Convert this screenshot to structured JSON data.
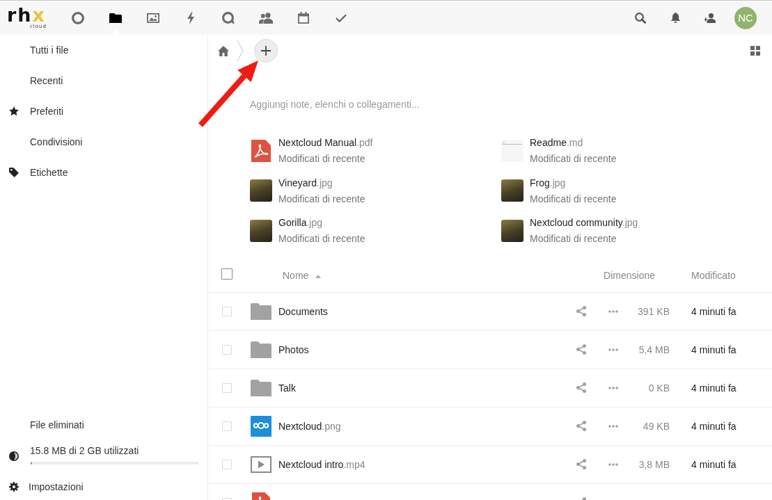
{
  "header": {
    "logo": {
      "parts": [
        {
          "text": "rh",
          "accent": false
        },
        {
          "text": "x",
          "accent": true
        }
      ],
      "subtitle": "cloud"
    },
    "apps": [
      {
        "kind": "ring",
        "selected": false
      },
      {
        "kind": "folder",
        "selected": true
      },
      {
        "kind": "image",
        "selected": false
      },
      {
        "kind": "bolt",
        "selected": false
      },
      {
        "kind": "chat",
        "selected": false
      },
      {
        "kind": "people",
        "selected": false
      },
      {
        "kind": "calendar",
        "selected": false
      },
      {
        "kind": "check",
        "selected": false
      }
    ],
    "tools": [
      {
        "kind": "search"
      },
      {
        "kind": "bell"
      },
      {
        "kind": "person"
      }
    ],
    "avatar": {
      "initials": "NC"
    }
  },
  "sidebar": {
    "items": [
      {
        "kind": "plain",
        "label": "Tutti i file"
      },
      {
        "kind": "plain",
        "label": "Recenti"
      },
      {
        "kind": "star",
        "label": "Preferiti"
      },
      {
        "kind": "plain",
        "label": "Condivisioni"
      },
      {
        "kind": "tag",
        "label": "Etichette"
      }
    ],
    "footer": [
      {
        "kind": "link",
        "label": "File eliminati"
      },
      {
        "kind": "quota",
        "label": "15.8 MB di 2 GB utilizzati",
        "level": 0.008
      },
      {
        "kind": "settings",
        "label": "Impostazioni"
      }
    ]
  },
  "controls": {
    "breadcrumbs": [
      {
        "kind": "home"
      }
    ],
    "new_button": {
      "kind": "plus"
    },
    "view_switch": {
      "kind": "grid"
    }
  },
  "workspace": {
    "placeholder": "Aggiungi note, elenchi o collegamenti..."
  },
  "recent": [
    {
      "kind": "pdf",
      "name": "Nextcloud Manual",
      "ext": ".pdf",
      "subtitle": "Modificati di recente"
    },
    {
      "kind": "text",
      "name": "Readme",
      "ext": ".md",
      "subtitle": "Modificati di recente"
    },
    {
      "kind": "photo",
      "name": "Vineyard",
      "ext": ".jpg",
      "subtitle": "Modificati di recente"
    },
    {
      "kind": "photo",
      "name": "Frog",
      "ext": ".jpg",
      "subtitle": "Modificati di recente"
    },
    {
      "kind": "photo",
      "name": "Gorilla",
      "ext": ".jpg",
      "subtitle": "Modificati di recente"
    },
    {
      "kind": "photo",
      "name": "Nextcloud community",
      "ext": ".jpg",
      "subtitle": "Modificati di recente"
    }
  ],
  "table": {
    "select_all": {
      "checked": false
    },
    "columns": [
      {
        "label": "Nome",
        "sorted": true
      },
      {
        "label": "Dimensione",
        "sorted": false
      },
      {
        "label": "Modificato",
        "sorted": false
      }
    ],
    "rows": [
      {
        "kind": "folder",
        "name": "Documents",
        "size": "391 KB",
        "modified": "4 minuti fa",
        "checked": false
      },
      {
        "kind": "folder",
        "name": "Photos",
        "size": "5,4 MB",
        "modified": "4 minuti fa",
        "checked": false
      },
      {
        "kind": "folder",
        "name": "Talk",
        "size": "0 KB",
        "modified": "4 minuti fa",
        "checked": false
      },
      {
        "kind": "image",
        "name": "Nextcloud",
        "ext": ".png",
        "size": "49 KB",
        "modified": "4 minuti fa",
        "checked": false
      },
      {
        "kind": "video",
        "name": "Nextcloud intro",
        "ext": ".mp4",
        "size": "3,8 MB",
        "modified": "4 minuti fa",
        "checked": false
      },
      {
        "kind": "pdf",
        "checked": false
      }
    ]
  },
  "annotation": {
    "kind": "arrow"
  }
}
